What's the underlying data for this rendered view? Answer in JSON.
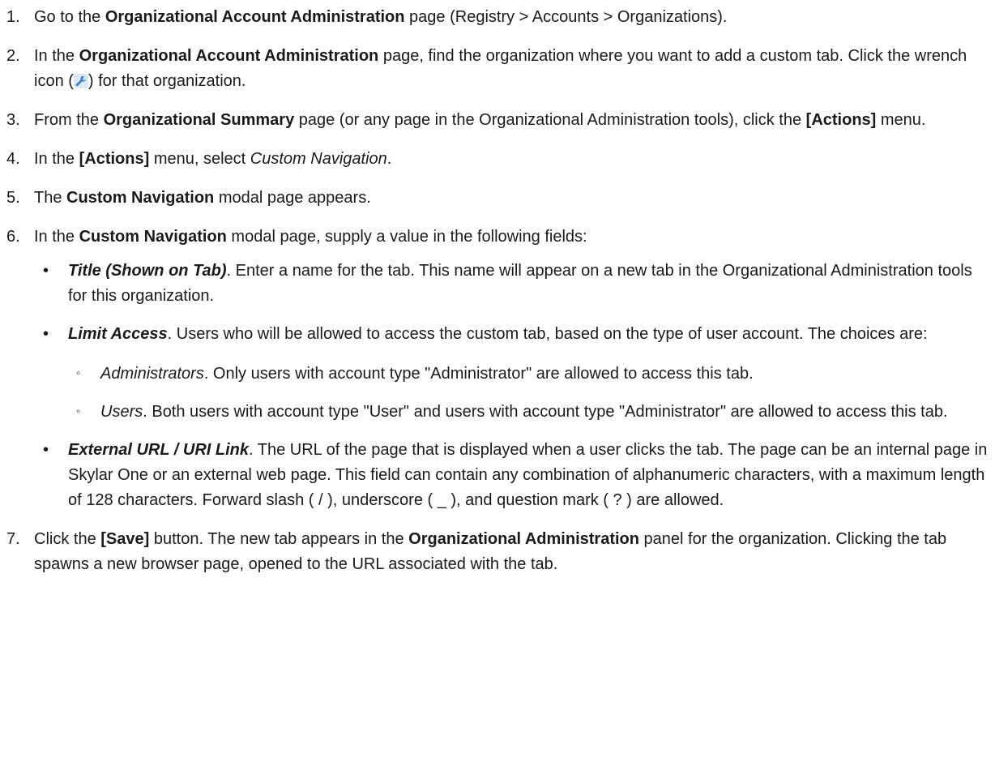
{
  "steps": [
    {
      "num": "1.",
      "a": "Go to the ",
      "b": "Organizational Account Administration",
      "c": " page (Registry > Accounts > Organizations)."
    },
    {
      "num": "2.",
      "a": "In the ",
      "b": "Organizational Account Administration",
      "c": " page, find the organization where you want to add a custom tab. Click the wrench icon (",
      "d": ") for that organization."
    },
    {
      "num": "3.",
      "a": "From the ",
      "b": "Organizational Summary",
      "c": " page (or any page in the Organizational Administration tools), click the ",
      "d": "[Actions]",
      "e": " menu."
    },
    {
      "num": "4.",
      "a": "In the ",
      "b": "[Actions]",
      "c": " menu, select ",
      "d": "Custom Navigation",
      "e": "."
    },
    {
      "num": "5.",
      "a": "The ",
      "b": "Custom Navigation",
      "c": " modal page appears."
    },
    {
      "num": "6.",
      "a": "In the ",
      "b": "Custom Navigation",
      "c": " modal page, supply a value in the following fields:"
    },
    {
      "num": "7.",
      "a": "Click the ",
      "b": "[Save]",
      "c": " button. The new tab appears in the ",
      "d": "Organizational Administration",
      "e": " panel for the organization. Clicking the tab spawns a new browser page, opened to the URL associated with the tab."
    }
  ],
  "fields": [
    {
      "bullet": "•",
      "name": "Title (Shown on Tab)",
      "desc": ". Enter a name for the tab. This name will appear on a new tab in the Organizational Administration tools for this organization."
    },
    {
      "bullet": "•",
      "name": "Limit Access",
      "desc": ". Users who will be allowed to access the custom tab, based on the type of user account. The choices are:"
    },
    {
      "bullet": "•",
      "name": "External URL / URI Link",
      "desc": ". The URL of the page that is displayed when a user clicks the tab. The page can be an internal page in Skylar One or an external web page. This field can contain any combination of alphanumeric characters, with a maximum length of 128 characters. Forward slash ( / ), underscore ( _ ), and question mark ( ? ) are allowed."
    }
  ],
  "choices": [
    {
      "marker": "◦",
      "name": "Administrators",
      "desc": ". Only users with account type \"Administrator\" are allowed to access this tab."
    },
    {
      "marker": "◦",
      "name": "Users",
      "desc": ". Both users with account type \"User\" and users with account type \"Administrator\" are allowed to access this tab."
    }
  ],
  "icons": {
    "wrench": "wrench-icon",
    "accent": "#3a7dc9"
  }
}
